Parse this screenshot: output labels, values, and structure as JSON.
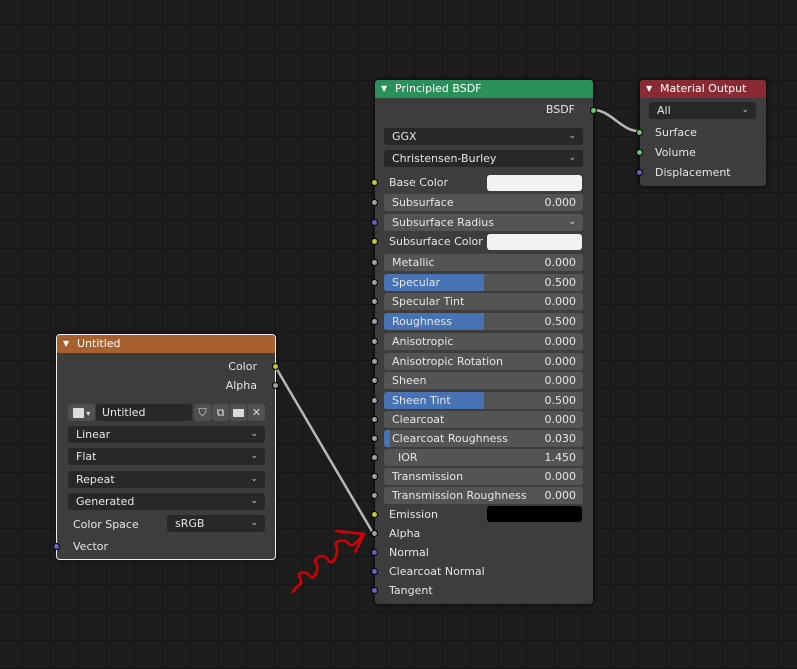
{
  "colors": {
    "background": "#1d1d1d",
    "node_body": "#3d3d3d",
    "shader_header": "#29905a",
    "output_header": "#8b2a33",
    "texture_header": "#a8602f",
    "slider_fill": "#4772b3",
    "socket_color": "#c7c729",
    "socket_float": "#a1a1a1",
    "socket_vector": "#6363c7",
    "socket_shader": "#63c763",
    "annotation": "#d40000",
    "base_color_swatch": "#f2f2f2",
    "subsurface_color_swatch": "#f2f2f2",
    "emission_swatch": "#000000"
  },
  "image_texture": {
    "title": "Untitled",
    "outputs": [
      "Color",
      "Alpha"
    ],
    "image_name": "Untitled",
    "interpolation": "Linear",
    "projection": "Flat",
    "extension": "Repeat",
    "source": "Generated",
    "color_space_label": "Color Space",
    "color_space": "sRGB",
    "inputs": [
      "Vector"
    ],
    "icons": [
      "image-browse-icon",
      "chevron-down-icon",
      "fake-user-shield-icon",
      "duplicate-icon",
      "open-folder-icon",
      "close-icon"
    ]
  },
  "bsdf": {
    "title": "Principled BSDF",
    "output": "BSDF",
    "distribution": "GGX",
    "subsurface_method": "Christensen-Burley",
    "base_color_label": "Base Color",
    "subsurface_color_label": "Subsurface Color",
    "subsurface_radius_label": "Subsurface Radius",
    "emission_label": "Emission",
    "fields": [
      {
        "label": "Subsurface",
        "value": "0.000",
        "fill": 0.0
      },
      {
        "label": "Metallic",
        "value": "0.000",
        "fill": 0.0
      },
      {
        "label": "Specular",
        "value": "0.500",
        "fill": 0.5
      },
      {
        "label": "Specular Tint",
        "value": "0.000",
        "fill": 0.0
      },
      {
        "label": "Roughness",
        "value": "0.500",
        "fill": 0.5
      },
      {
        "label": "Anisotropic",
        "value": "0.000",
        "fill": 0.0
      },
      {
        "label": "Anisotropic Rotation",
        "value": "0.000",
        "fill": 0.0
      },
      {
        "label": "Sheen",
        "value": "0.000",
        "fill": 0.0
      },
      {
        "label": "Sheen Tint",
        "value": "0.500",
        "fill": 0.5
      },
      {
        "label": "Clearcoat",
        "value": "0.000",
        "fill": 0.0
      },
      {
        "label": "Clearcoat Roughness",
        "value": "0.030",
        "fill": 0.03
      },
      {
        "label": "IOR",
        "value": "1.450",
        "fill": 0.0
      },
      {
        "label": "Transmission",
        "value": "0.000",
        "fill": 0.0
      },
      {
        "label": "Transmission Roughness",
        "value": "0.000",
        "fill": 0.0
      }
    ],
    "vector_inputs": [
      "Alpha",
      "Normal",
      "Clearcoat Normal",
      "Tangent"
    ]
  },
  "material_output": {
    "title": "Material Output",
    "target": "All",
    "inputs": [
      "Surface",
      "Volume",
      "Displacement"
    ]
  }
}
